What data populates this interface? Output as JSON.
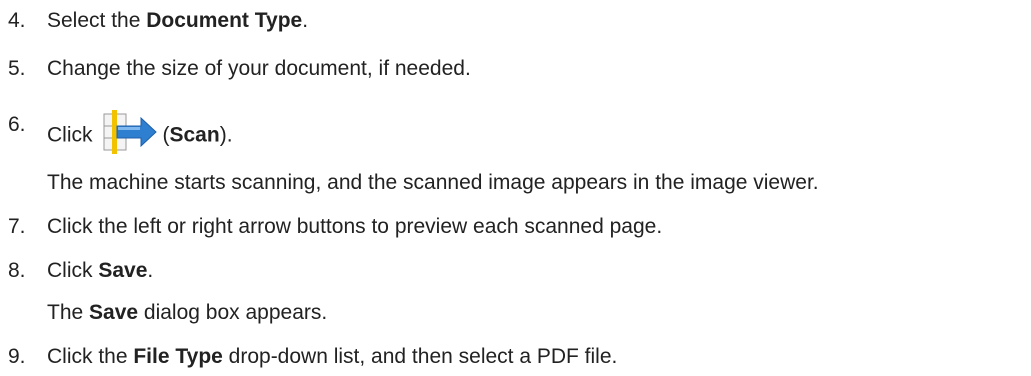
{
  "steps": [
    {
      "number": "4.",
      "pre": "Select the ",
      "bold": "Document Type",
      "post": "."
    },
    {
      "number": "5.",
      "text": "Change the size of your document, if needed."
    },
    {
      "number": "6.",
      "pre": "Click",
      "icon": "scan-icon",
      "mid": "(",
      "bold": "Scan",
      "post": ")."
    },
    {
      "note": "The machine starts scanning, and the scanned image appears in the image viewer."
    },
    {
      "number": "7.",
      "text": "Click the left or right arrow buttons to preview each scanned page."
    },
    {
      "number": "8.",
      "pre": "Click ",
      "bold": "Save",
      "post": "."
    },
    {
      "note_pre": "The ",
      "note_bold": "Save",
      "note_post": " dialog box appears."
    },
    {
      "number": "9.",
      "pre": "Click the ",
      "bold": "File Type",
      "post": " drop-down list, and then select a PDF file."
    }
  ]
}
